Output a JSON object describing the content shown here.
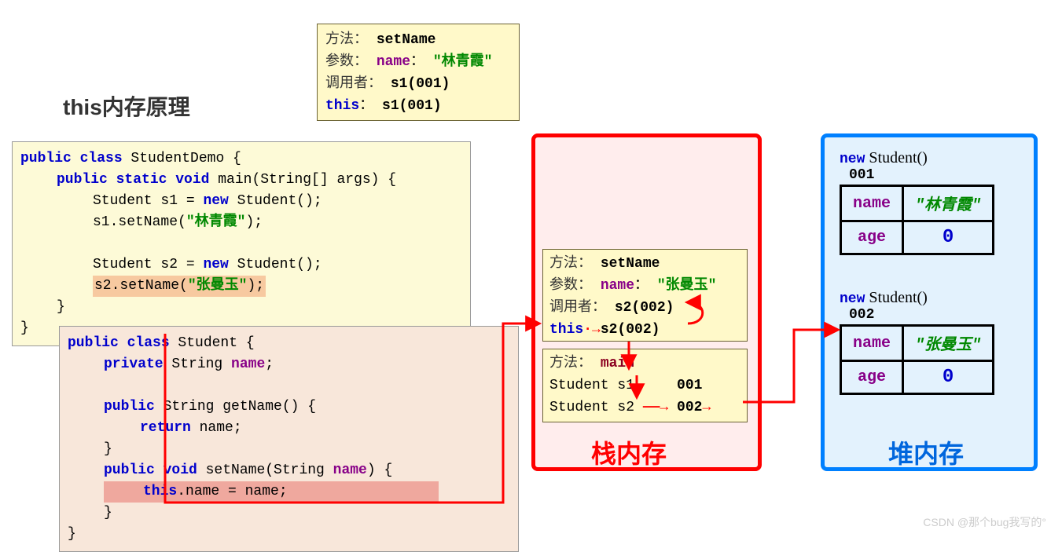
{
  "title": "this内存原理",
  "top_info": {
    "method_lbl": "方法：",
    "method_val": "setName",
    "param_lbl": "参数：",
    "param_name": "name",
    "colon": "：",
    "param_val": "\"林青霞\"",
    "caller_lbl": "调用者：",
    "caller_val": "s1(001)",
    "this_lbl": "this",
    "this_val": "s1(001)"
  },
  "code1": {
    "l1_kw1": "public class",
    "l1_cls": " StudentDemo {",
    "l2_kw1": "public static void",
    "l2_rest": " main(String[] args) {",
    "l3a": "Student s1 = ",
    "l3_kw": "new",
    "l3b": " Student();",
    "l4a": "s1.setName(",
    "l4_str": "\"林青霞\"",
    "l4b": ");",
    "l5a": "Student s2 = ",
    "l5_kw": "new",
    "l5b": " Student();",
    "l6a": "s2.setName(",
    "l6_str": "\"张曼玉\"",
    "l6b": ");",
    "brace": "}"
  },
  "code2": {
    "l1_kw": "public class",
    "l1_rest": " Student {",
    "l2_kw": "private",
    "l2_rest": " String ",
    "l2_name": "name",
    "l2_end": ";",
    "l3_kw": "public",
    "l3_rest": " String getName() {",
    "l4_kw": "return",
    "l4_rest": " name;",
    "l5_kw": "public void",
    "l5_rest": " setName(String ",
    "l5_name": "name",
    "l5_end": ") {",
    "l6_this": "this",
    "l6_rest": ".name = name;",
    "brace": "}"
  },
  "stack": {
    "label": "栈内存",
    "frame1": {
      "method_lbl": "方法：",
      "method_val": "setName",
      "param_lbl": "参数：",
      "param_name": "name",
      "colon": "：",
      "param_val": "\"张曼玉\"",
      "caller_lbl": "调用者：",
      "caller_val": "s2(002)",
      "this_lbl": "this",
      "this_val": "s2(002)"
    },
    "frame2": {
      "method_lbl": "方法：",
      "method_val": "main",
      "s1_lbl": "Student s1",
      "s1_val": "001",
      "s2_lbl": "Student s2",
      "s2_val": "002"
    }
  },
  "heap": {
    "label": "堆内存",
    "obj1": {
      "new": "new",
      "cls": " Student()",
      "id": "001",
      "f1": "name",
      "v1": "\"林青霞\"",
      "f2": "age",
      "v2": "0"
    },
    "obj2": {
      "new": "new",
      "cls": " Student()",
      "id": "002",
      "f1": "name",
      "v1": "\"张曼玉\"",
      "f2": "age",
      "v2": "0"
    }
  },
  "watermark": "CSDN @那个bug我写的°"
}
